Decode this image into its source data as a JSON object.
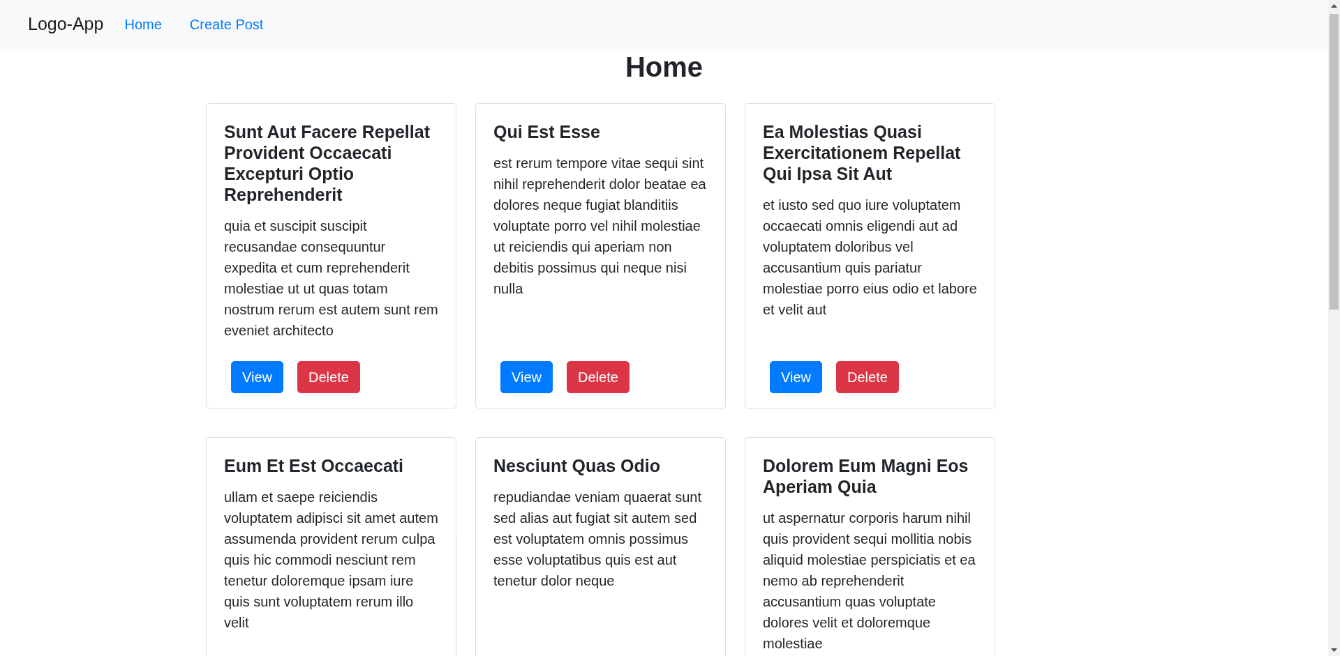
{
  "navbar": {
    "brand": "Logo-App",
    "links": [
      {
        "label": "Home"
      },
      {
        "label": "Create Post"
      }
    ]
  },
  "page_title": "Home",
  "posts": [
    {
      "title": "Sunt Aut Facere Repellat Provident Occaecati Excepturi Optio Reprehenderit",
      "body": "quia et suscipit suscipit recusandae consequuntur expedita et cum reprehenderit molestiae ut ut quas totam nostrum rerum est autem sunt rem eveniet architecto",
      "actions": [
        {
          "label": "View",
          "kind": "view"
        },
        {
          "label": "Delete",
          "kind": "delete"
        }
      ]
    },
    {
      "title": "Qui Est Esse",
      "body": "est rerum tempore vitae sequi sint nihil reprehenderit dolor beatae ea dolores neque fugiat blanditiis voluptate porro vel nihil molestiae ut reiciendis qui aperiam non debitis possimus qui neque nisi nulla",
      "actions": [
        {
          "label": "View",
          "kind": "view"
        },
        {
          "label": "Delete",
          "kind": "delete"
        }
      ]
    },
    {
      "title": "Ea Molestias Quasi Exercitationem Repellat Qui Ipsa Sit Aut",
      "body": "et iusto sed quo iure voluptatem occaecati omnis eligendi aut ad voluptatem doloribus vel accusantium quis pariatur molestiae porro eius odio et labore et velit aut",
      "actions": [
        {
          "label": "View",
          "kind": "view"
        },
        {
          "label": "Delete",
          "kind": "delete"
        }
      ]
    },
    {
      "title": "Eum Et Est Occaecati",
      "body": "ullam et saepe reiciendis voluptatem adipisci sit amet autem assumenda provident rerum culpa quis hic commodi nesciunt rem tenetur doloremque ipsam iure quis sunt voluptatem rerum illo velit"
    },
    {
      "title": "Nesciunt Quas Odio",
      "body": "repudiandae veniam quaerat sunt sed alias aut fugiat sit autem sed est voluptatem omnis possimus esse voluptatibus quis est aut tenetur dolor neque"
    },
    {
      "title": "Dolorem Eum Magni Eos Aperiam Quia",
      "body": "ut aspernatur corporis harum nihil quis provident sequi mollitia nobis aliquid molestiae perspiciatis et ea nemo ab reprehenderit accusantium quas voluptate dolores velit et doloremque molestiae"
    }
  ]
}
